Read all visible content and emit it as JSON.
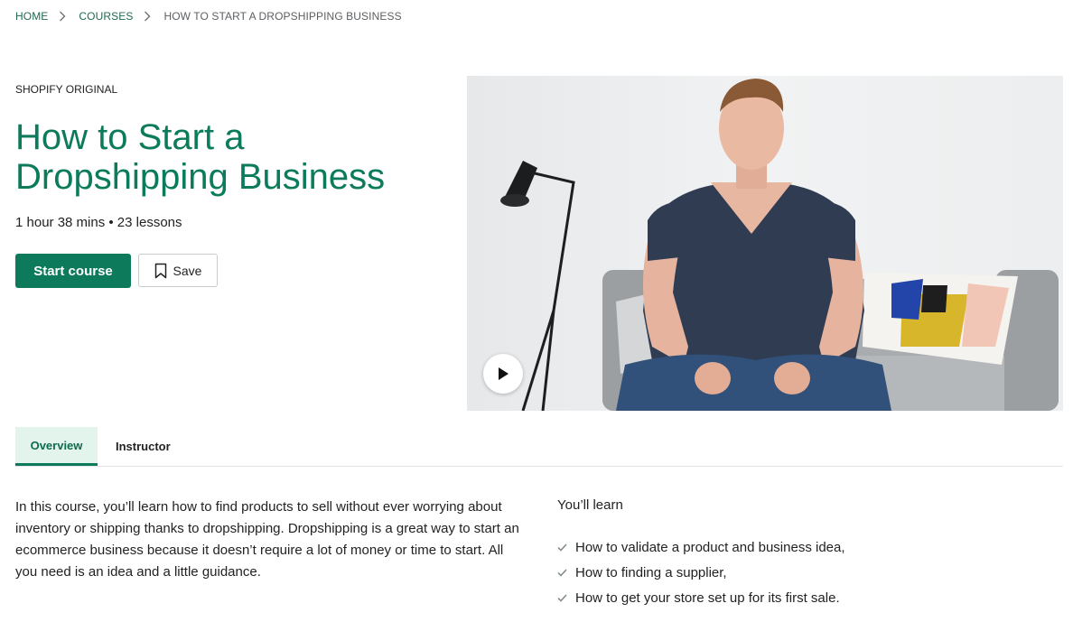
{
  "breadcrumb": {
    "items": [
      "HOME",
      "COURSES"
    ],
    "current": "HOW TO START A DROPSHIPPING BUSINESS"
  },
  "course": {
    "eyebrow": "SHOPIFY ORIGINAL",
    "title": "How to Start a Dropshipping Business",
    "meta": "1 hour 38 mins • 23 lessons",
    "start_label": "Start course",
    "save_label": "Save"
  },
  "tabs": [
    {
      "label": "Overview",
      "active": true
    },
    {
      "label": "Instructor",
      "active": false
    }
  ],
  "overview": {
    "text": "In this course, you’ll learn how to find products to sell without ever worrying about inventory or shipping thanks to dropshipping. Dropshipping is a great way to start an ecommerce business because it doesn’t require a lot of money or time to start. All you need is an idea and a little guidance.",
    "learn_heading": "You’ll learn",
    "learn_items": [
      "How to validate a product and business idea,",
      "How to finding a supplier,",
      "How to get your store set up for its first sale."
    ]
  },
  "icons": {
    "breadcrumb_separator": "chevron-right-icon",
    "save": "bookmark-icon",
    "play": "play-icon",
    "check": "checkmark-icon"
  },
  "colors": {
    "brand_green": "#0d7a5b",
    "title_green": "#0c7b5c",
    "tab_active_bg": "#e3f4ec"
  }
}
